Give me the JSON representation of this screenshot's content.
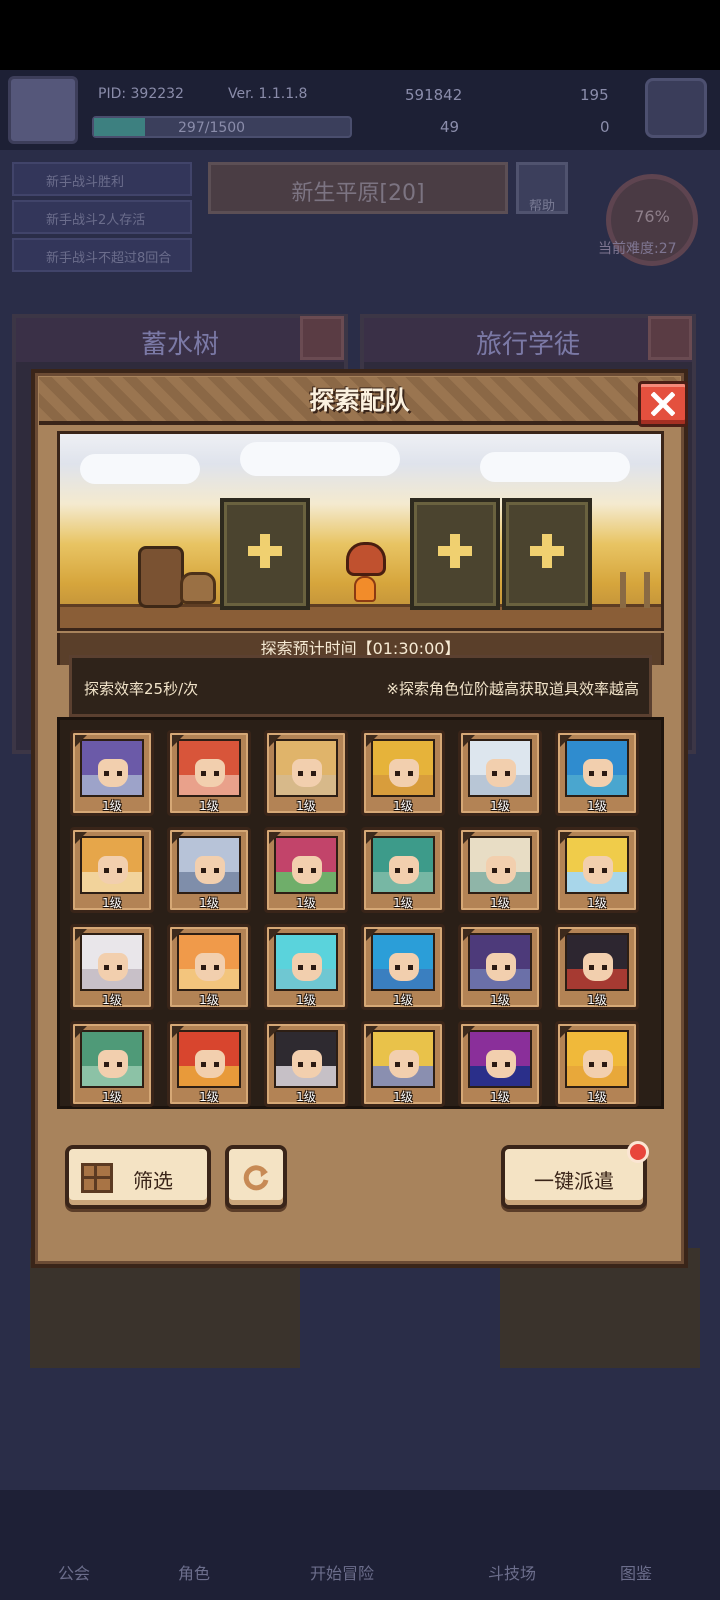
{
  "background": {
    "player_id": "PID: 392232",
    "version": "Ver. 1.1.1.8",
    "currency_gold": "591842",
    "currency_gem": "195",
    "currency_3": "49",
    "currency_4": "0",
    "xp_text": "297/1500",
    "xp_ratio": 0.198,
    "quests": [
      "新手战斗胜利",
      "新手战斗2人存活",
      "新手战斗不超过8回合"
    ],
    "stage": "新生平原[20]",
    "help": "帮助",
    "progress_percent": "76%",
    "difficulty": "当前难度:27",
    "panel_left_title": "蓄水树",
    "panel_right_title": "旅行学徒",
    "nav": [
      "公会",
      "角色",
      "开始冒险",
      "斗技场",
      "图鉴"
    ]
  },
  "modal": {
    "title": "探索配队",
    "time_estimate": "探索预计时间【01:30:00】",
    "efficiency": "探索效率25秒/次",
    "note": "※探索角色位阶越高获取道具效率越高",
    "filter_label": "筛选",
    "dispatch_label": "一键派遣"
  },
  "heroes": [
    {
      "level": "1级",
      "hair": "#6b5aa8",
      "bg": "#9da3c9"
    },
    {
      "level": "1级",
      "hair": "#d8553a",
      "bg": "#e9a18b"
    },
    {
      "level": "1级",
      "hair": "#e0b46a",
      "bg": "#d7b98a"
    },
    {
      "level": "1级",
      "hair": "#e6b33a",
      "bg": "#d89d3c"
    },
    {
      "level": "1级",
      "hair": "#dde6ee",
      "bg": "#b8c6d6"
    },
    {
      "level": "1级",
      "hair": "#2f8ccf",
      "bg": "#4aa6cf"
    },
    {
      "level": "1级",
      "hair": "#e6a64a",
      "bg": "#f2d39b"
    },
    {
      "level": "1级",
      "hair": "#b7c3d8",
      "bg": "#7f8eaa"
    },
    {
      "level": "1级",
      "hair": "#c2446a",
      "bg": "#6fae6a"
    },
    {
      "level": "1级",
      "hair": "#3d9b8a",
      "bg": "#77b7a4"
    },
    {
      "level": "1级",
      "hair": "#e8ddc5",
      "bg": "#8fb5a8"
    },
    {
      "level": "1级",
      "hair": "#f0cc4a",
      "bg": "#a8d6ea"
    },
    {
      "level": "1级",
      "hair": "#e9e6ea",
      "bg": "#c8c0c8"
    },
    {
      "level": "1级",
      "hair": "#f09a4a",
      "bg": "#f3c57d"
    },
    {
      "level": "1级",
      "hair": "#5ad3dc",
      "bg": "#6fc7d2"
    },
    {
      "level": "1级",
      "hair": "#2b9ed8",
      "bg": "#3a7fc0"
    },
    {
      "level": "1级",
      "hair": "#4d3a7a",
      "bg": "#6b70a8"
    },
    {
      "level": "1级",
      "hair": "#2d2630",
      "bg": "#a63a32"
    },
    {
      "level": "1级",
      "hair": "#4f9a78",
      "bg": "#8cc2a6"
    },
    {
      "level": "1级",
      "hair": "#d8452e",
      "bg": "#e89a3a"
    },
    {
      "level": "1级",
      "hair": "#2e2a30",
      "bg": "#c6c0c6"
    },
    {
      "level": "1级",
      "hair": "#e9c24a",
      "bg": "#8a8fb0"
    },
    {
      "level": "1级",
      "hair": "#8a2f9a",
      "bg": "#2a2f8a"
    },
    {
      "level": "1级",
      "hair": "#f0b93a",
      "bg": "#e8a83a"
    }
  ]
}
